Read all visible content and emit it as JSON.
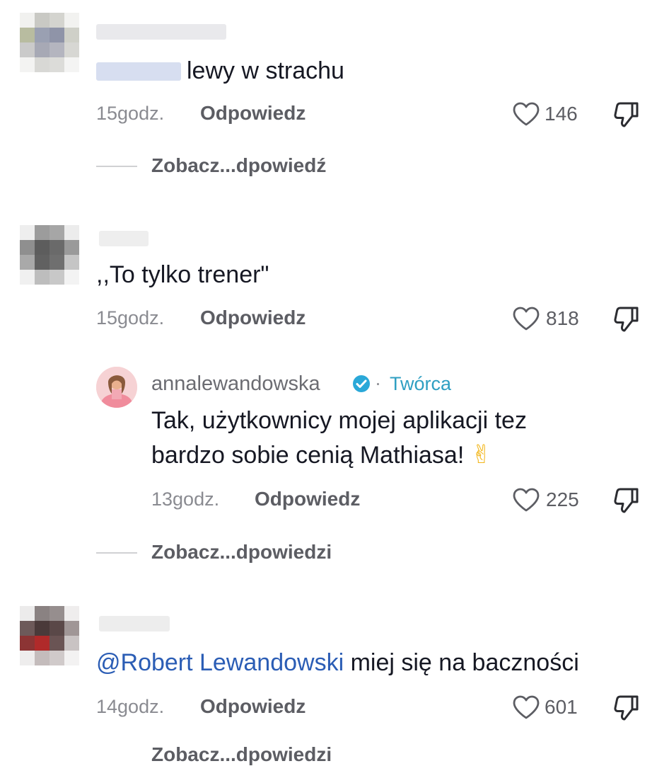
{
  "comments": [
    {
      "text": "lewy w strachu",
      "time": "15godz.",
      "reply_label": "Odpowiedz",
      "likes": "146",
      "view_replies": "Zobacz...dpowiedź"
    },
    {
      "text": ",,To tylko trener\"",
      "time": "15godz.",
      "reply_label": "Odpowiedz",
      "likes": "818",
      "reply": {
        "username": "annalewandowska",
        "separator": "·",
        "badge": "Twórca",
        "text_line1": "Tak, użytkownicy mojej aplikacji tez",
        "text_line2": "bardzo sobie cenią Mathiasa!",
        "emoji": "✌",
        "time": "13godz.",
        "reply_label": "Odpowiedz",
        "likes": "225"
      },
      "view_replies": "Zobacz...dpowiedzi"
    },
    {
      "mention": "@Robert Lewandowski",
      "text": "miej się na baczności",
      "time": "14godz.",
      "reply_label": "Odpowiedz",
      "likes": "601",
      "view_replies": "Zobacz...dpowiedzi"
    }
  ],
  "icons": {
    "like": "heart-outline-icon",
    "dislike": "thumbs-down-icon",
    "verified": "verified-badge-icon"
  },
  "colors": {
    "mention": "#2b5db5",
    "creator_badge": "#2f9fc2",
    "verified": "#2aa8d8"
  }
}
